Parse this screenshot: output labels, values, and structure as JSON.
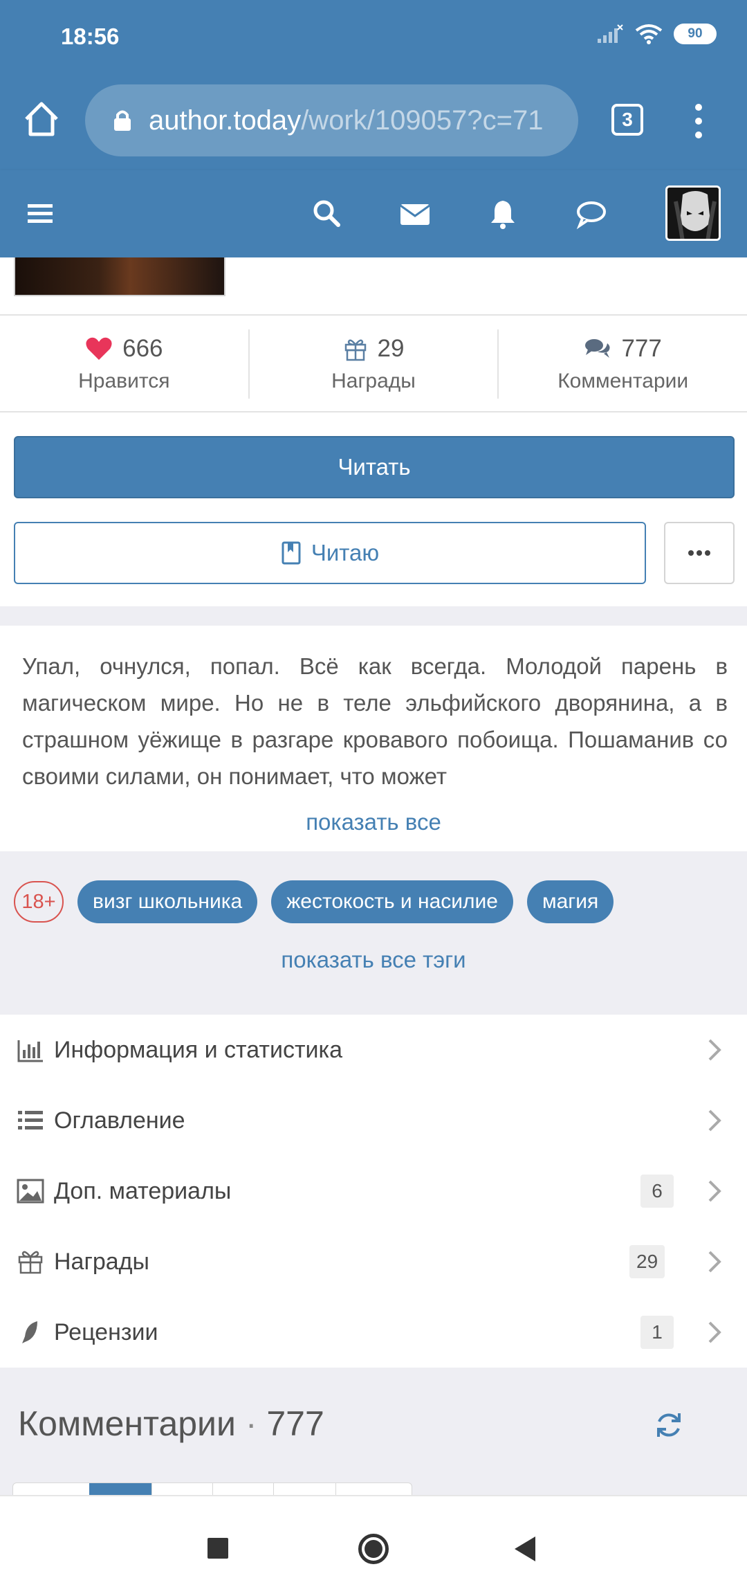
{
  "status_bar": {
    "time": "18:56",
    "battery": "90"
  },
  "browser": {
    "url_host": "author.today",
    "url_path": "/work/109057?c=71",
    "tab_count": "3"
  },
  "site_nav": {
    "icons": [
      "menu-icon",
      "search-icon",
      "mail-icon",
      "bell-icon",
      "chat-icon"
    ]
  },
  "stats": {
    "likes": {
      "count": "666",
      "label": "Нравится"
    },
    "awards": {
      "count": "29",
      "label": "Награды"
    },
    "comments": {
      "count": "777",
      "label": "Комментарии"
    }
  },
  "actions": {
    "read_label": "Читать",
    "reading_label": "Читаю"
  },
  "annotation": {
    "text": "Упал, очнулся, попал. Всё как всегда. Молодой парень в магическом мире. Но не в теле эльфийского дворянина, а в страшном уёжище в разгаре кровавого побоища. Пошаманив со своими силами, он понимает, что может",
    "show_all": "показать все"
  },
  "tags": {
    "age_rating": "18+",
    "items": [
      "визг школьника",
      "жестокость и насилие",
      "магия"
    ],
    "show_all": "показать все тэги"
  },
  "menu": {
    "items": [
      {
        "label": "Информация и статистика",
        "icon": "chart-icon",
        "badge": ""
      },
      {
        "label": "Оглавление",
        "icon": "list-icon",
        "badge": ""
      },
      {
        "label": "Доп. материалы",
        "icon": "image-icon",
        "badge": "6"
      },
      {
        "label": "Награды",
        "icon": "gift-icon",
        "badge": "29"
      },
      {
        "label": "Рецензии",
        "icon": "feather-icon",
        "badge": "1"
      }
    ]
  },
  "comments_header": {
    "title": "Комментарии",
    "separator": " · ",
    "count": "777"
  },
  "colors": {
    "brand": "#4580b3",
    "like": "#e8355a",
    "age_badge": "#d9534f"
  }
}
